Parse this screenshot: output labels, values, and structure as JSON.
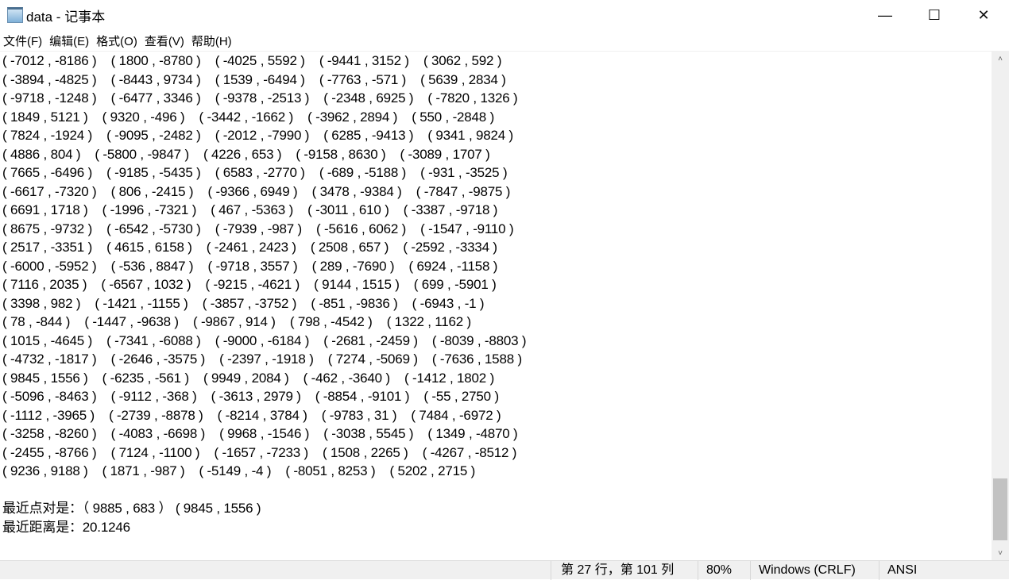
{
  "window": {
    "title": "data - 记事本",
    "minimize": "—",
    "maximize": "☐",
    "close": "✕"
  },
  "menu": [
    "文件(F)",
    "编辑(E)",
    "格式(O)",
    "查看(V)",
    "帮助(H)"
  ],
  "editor": {
    "lines": [
      "( -7012 , -8186 )    ( 1800 , -8780 )    ( -4025 , 5592 )    ( -9441 , 3152 )    ( 3062 , 592 )",
      "( -3894 , -4825 )    ( -8443 , 9734 )    ( 1539 , -6494 )    ( -7763 , -571 )    ( 5639 , 2834 )",
      "( -9718 , -1248 )    ( -6477 , 3346 )    ( -9378 , -2513 )    ( -2348 , 6925 )    ( -7820 , 1326 )",
      "( 1849 , 5121 )    ( 9320 , -496 )    ( -3442 , -1662 )    ( -3962 , 2894 )    ( 550 , -2848 )",
      "( 7824 , -1924 )    ( -9095 , -2482 )    ( -2012 , -7990 )    ( 6285 , -9413 )    ( 9341 , 9824 )",
      "( 4886 , 804 )    ( -5800 , -9847 )    ( 4226 , 653 )    ( -9158 , 8630 )    ( -3089 , 1707 )",
      "( 7665 , -6496 )    ( -9185 , -5435 )    ( 6583 , -2770 )    ( -689 , -5188 )    ( -931 , -3525 )",
      "( -6617 , -7320 )    ( 806 , -2415 )    ( -9366 , 6949 )    ( 3478 , -9384 )    ( -7847 , -9875 )",
      "( 6691 , 1718 )    ( -1996 , -7321 )    ( 467 , -5363 )    ( -3011 , 610 )    ( -3387 , -9718 )",
      "( 8675 , -9732 )    ( -6542 , -5730 )    ( -7939 , -987 )    ( -5616 , 6062 )    ( -1547 , -9110 )",
      "( 2517 , -3351 )    ( 4615 , 6158 )    ( -2461 , 2423 )    ( 2508 , 657 )    ( -2592 , -3334 )",
      "( -6000 , -5952 )    ( -536 , 8847 )    ( -9718 , 3557 )    ( 289 , -7690 )    ( 6924 , -1158 )",
      "( 7116 , 2035 )    ( -6567 , 1032 )    ( -9215 , -4621 )    ( 9144 , 1515 )    ( 699 , -5901 )",
      "( 3398 , 982 )    ( -1421 , -1155 )    ( -3857 , -3752 )    ( -851 , -9836 )    ( -6943 , -1 )",
      "( 78 , -844 )    ( -1447 , -9638 )    ( -9867 , 914 )    ( 798 , -4542 )    ( 1322 , 1162 )",
      "( 1015 , -4645 )    ( -7341 , -6088 )    ( -9000 , -6184 )    ( -2681 , -2459 )    ( -8039 , -8803 )",
      "( -4732 , -1817 )    ( -2646 , -3575 )    ( -2397 , -1918 )    ( 7274 , -5069 )    ( -7636 , 1588 )",
      "( 9845 , 1556 )    ( -6235 , -561 )    ( 9949 , 2084 )    ( -462 , -3640 )    ( -1412 , 1802 )",
      "( -5096 , -8463 )    ( -9112 , -368 )    ( -3613 , 2979 )    ( -8854 , -9101 )    ( -55 , 2750 )",
      "( -1112 , -3965 )    ( -2739 , -8878 )    ( -8214 , 3784 )    ( -9783 , 31 )    ( 7484 , -6972 )",
      "( -3258 , -8260 )    ( -4083 , -6698 )    ( 9968 , -1546 )    ( -3038 , 5545 )    ( 1349 , -4870 )",
      "( -2455 , -8766 )    ( 7124 , -1100 )    ( -1657 , -7233 )    ( 1508 , 2265 )    ( -4267 , -8512 )",
      "( 9236 , 9188 )    ( 1871 , -987 )    ( -5149 , -4 )    ( -8051 , 8253 )    ( 5202 , 2715 )",
      "",
      "最近点对是：（ 9885 , 683 ） ( 9845 , 1556 )",
      "最近距离是：20.1246"
    ]
  },
  "scrollbar": {
    "up": "˄",
    "down": "˅",
    "position": 0.93
  },
  "status": {
    "position": "第 27 行，第 101 列",
    "zoom": "80%",
    "line_ending": "Windows (CRLF)",
    "encoding": "ANSI"
  }
}
